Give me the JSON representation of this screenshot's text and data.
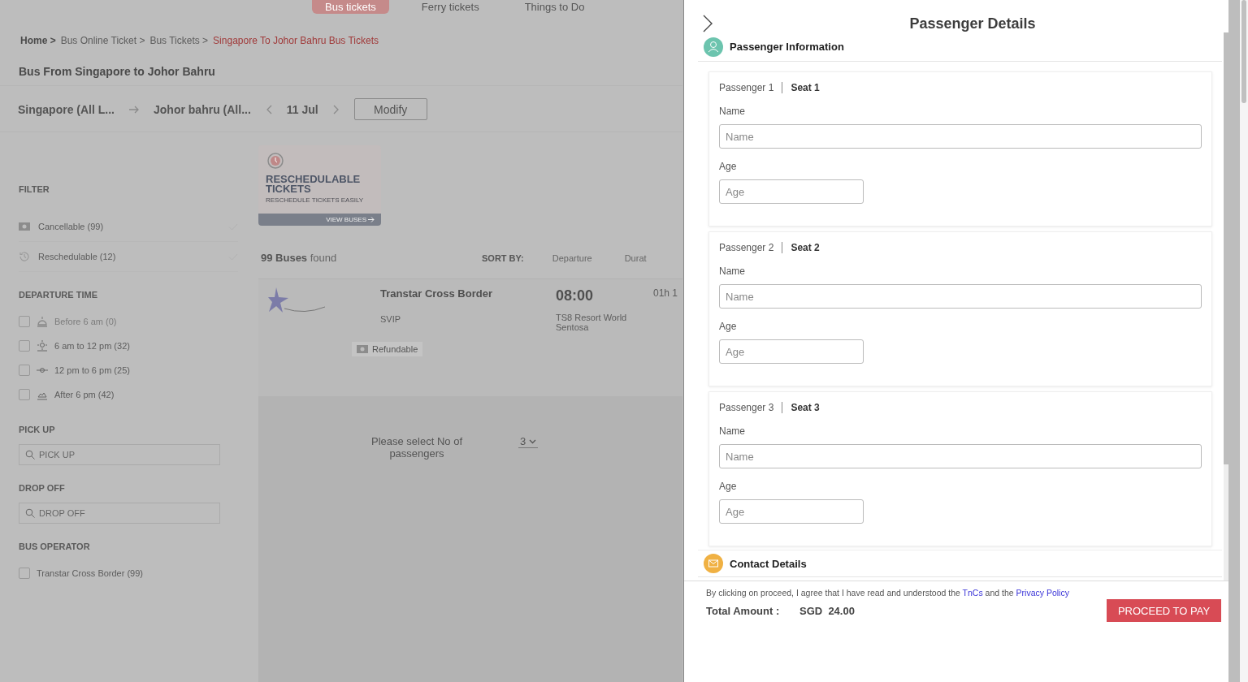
{
  "nav": [
    {
      "label": "Bus tickets",
      "selected": true
    },
    {
      "label": "Ferry tickets",
      "selected": false
    },
    {
      "label": "Things to Do",
      "selected": false
    }
  ],
  "breadcrumb": [
    {
      "label": "Home >",
      "current": false,
      "bold": true
    },
    {
      "label": "Bus Online Ticket >",
      "current": false,
      "bold": false
    },
    {
      "label": "Bus Tickets >",
      "current": false,
      "bold": false
    },
    {
      "label": "Singapore To Johor Bahru Bus Tickets",
      "current": true,
      "bold": false
    }
  ],
  "page_title": "Bus From Singapore to Johor Bahru",
  "search": {
    "from": "Singapore (All L...",
    "to": "Johor bahru (All...",
    "date": "11 Jul",
    "modify_button": "Modify"
  },
  "filter": {
    "heading": "FILTER",
    "options": [
      {
        "label": "Cancellable (99)",
        "kind": "cancellable"
      },
      {
        "label": "Reschedulable (12)",
        "kind": "reschedulable"
      }
    ]
  },
  "departure_time": {
    "heading": "DEPARTURE TIME",
    "options": [
      {
        "label": "Before 6 am (0)",
        "kind": "dawn",
        "disabled": true,
        "checked": false
      },
      {
        "label": "6 am to 12 pm (32)",
        "kind": "morning",
        "disabled": false,
        "checked": false
      },
      {
        "label": "12 pm to 6 pm (25)",
        "kind": "noon",
        "disabled": false,
        "checked": false
      },
      {
        "label": "After 6 pm (42)",
        "kind": "evening",
        "disabled": false,
        "checked": false
      }
    ]
  },
  "pick_up": {
    "heading": "PICK UP",
    "placeholder": "PICK UP"
  },
  "drop_off": {
    "heading": "DROP OFF",
    "placeholder": "DROP OFF"
  },
  "bus_operator": {
    "heading": "BUS OPERATOR",
    "options": [
      {
        "label": "Transtar Cross Border (99)",
        "checked": false
      }
    ]
  },
  "promo": {
    "title": "RESCHEDULABLE TICKETS",
    "subtitle": "RESCHEDULE TICKETS EASILY",
    "link": "VIEW BUSES"
  },
  "results": {
    "count": "99 Buses",
    "suffix": "found",
    "sort_label": "SORT BY:",
    "sort_options": [
      "Departure",
      "Durat"
    ]
  },
  "bus": {
    "operator": "Transtar Cross Border",
    "type": "SVIP",
    "time": "08:00",
    "duration": "01h 1",
    "location": "TS8 Resort World Sentosa",
    "tag": "Refundable"
  },
  "passenger_select": {
    "label": "Please select No of passengers",
    "value": "3"
  },
  "drawer": {
    "title": "Passenger Details",
    "info_heading": "Passenger Information",
    "passengers": [
      {
        "label": "Passenger 1",
        "seat": "Seat 1",
        "name_label": "Name",
        "name_placeholder": "Name",
        "age_label": "Age",
        "age_placeholder": "Age"
      },
      {
        "label": "Passenger 2",
        "seat": "Seat 2",
        "name_label": "Name",
        "name_placeholder": "Name",
        "age_label": "Age",
        "age_placeholder": "Age"
      },
      {
        "label": "Passenger 3",
        "seat": "Seat 3",
        "name_label": "Name",
        "name_placeholder": "Name",
        "age_label": "Age",
        "age_placeholder": "Age"
      }
    ],
    "contact_heading": "Contact Details",
    "agreement": {
      "before": "By clicking on proceed, I agree that I have read and understood the",
      "link_1": "TnCs",
      "middle": "and the",
      "link_2": "Privacy Policy"
    },
    "total_label": "Total Amount :",
    "total_amount": "SGD  24.00",
    "proceed_button": "PROCEED TO PAY"
  }
}
